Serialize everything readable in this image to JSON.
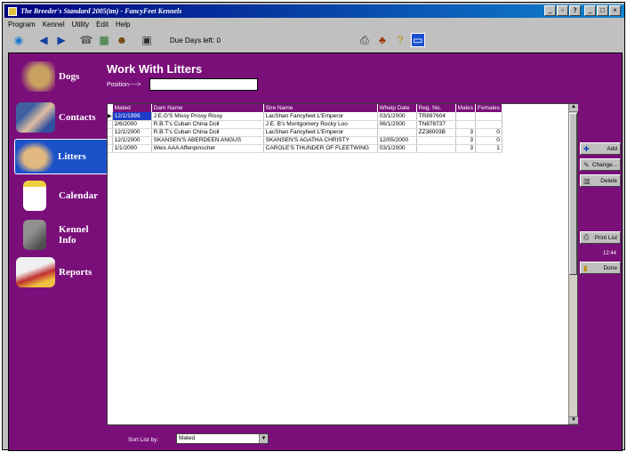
{
  "window": {
    "title": "The Breeder's Standard 2005(tm) - FancyFeet Kennels"
  },
  "menu": [
    "Program",
    "Kennel",
    "Utility",
    "Edit",
    "Help"
  ],
  "toolbar": {
    "icons": [
      "globe-icon",
      "back-icon",
      "forward-icon",
      "phone-icon",
      "chart-icon",
      "users-icon",
      "calendar-icon",
      "print-icon",
      "people-icon",
      "help-icon",
      "window-icon"
    ],
    "days_text": "Due Days left: 0"
  },
  "nav": {
    "dogs": "Dogs",
    "contacts": "Contacts",
    "litters": "Litters",
    "calendar": "Calendar",
    "kennel_info": "Kennel Info",
    "reports": "Reports"
  },
  "page": {
    "title": "Work With Litters",
    "position_label": "Position---->",
    "position_value": ""
  },
  "grid": {
    "columns": [
      "Mated",
      "Dam Name",
      "Sire Name",
      "Whelp Date",
      "Reg. No.",
      "Males",
      "Females"
    ],
    "rows": [
      [
        "12/1/1999",
        "J.E.G'S Missy Prissy Rissy",
        "LacShan Fancyfeet L'Emperor",
        "03/1/2000",
        "TR897604",
        "",
        ""
      ],
      [
        "2/6/2000",
        "R.B.T's Cuban China Doll",
        "J.E. B's Montgomery Rocky Loo",
        "06/1/2000",
        "TN878737",
        "",
        ""
      ],
      [
        "12/1/2000",
        "R.B.T's Cuban China Doll",
        "LacShan Fancyfeet L'Emperor",
        "",
        "ZZ38003B",
        "3",
        "0"
      ],
      [
        "12/1/2000",
        "SKANSEN'S ABERDEEN ANGUS",
        "SKANSEN'S AGATHA CHRISTY",
        "12/05/2000",
        "",
        "3",
        "0"
      ],
      [
        "1/1/2000",
        "Weis AAA Affenpinscher",
        "CAROLE'S THUNDER OF FLEETWING",
        "03/1/2000",
        "",
        "3",
        "1"
      ]
    ]
  },
  "buttons": {
    "add": "Add",
    "change": "Change...",
    "delete": "Delete",
    "print_list": "Print List",
    "done": "Done"
  },
  "clock": "12:44",
  "sort": {
    "label": "Sort List by:",
    "value": "Mated"
  },
  "colors": {
    "background": "#7a0f7a",
    "selection": "#1a3cc8"
  }
}
